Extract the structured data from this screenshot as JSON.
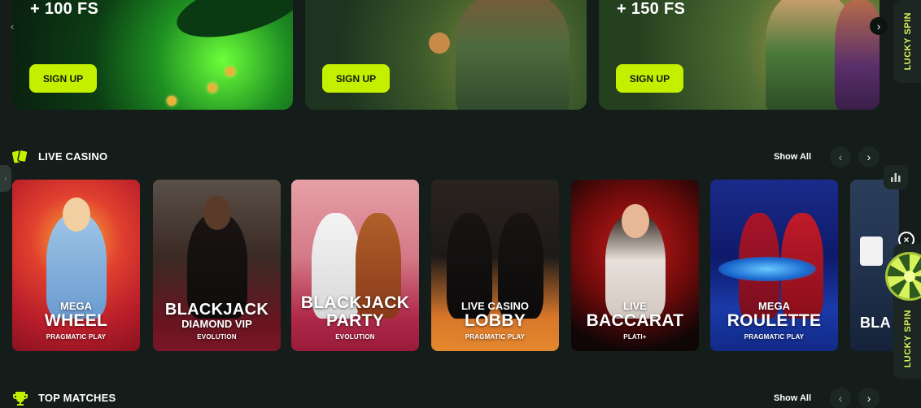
{
  "promos": [
    {
      "title": "+ 100 FS",
      "button": "SIGN UP"
    },
    {
      "title": "",
      "button": "SIGN UP"
    },
    {
      "title": "+ 150 FS",
      "button": "SIGN UP"
    }
  ],
  "live_casino": {
    "title": "LIVE CASINO",
    "show_all": "Show All",
    "games": [
      {
        "line1": "MEGA",
        "line2": "WHEEL",
        "provider": "PRAGMATIC PLAY"
      },
      {
        "line1": "BLACKJACK",
        "line2": "DIAMOND VIP",
        "provider": "EVOLUTION"
      },
      {
        "line1": "BLACKJACK",
        "line2": "PARTY",
        "provider": "EVOLUTION"
      },
      {
        "line1": "LIVE CASINO",
        "line2": "LOBBY",
        "provider": "PRAGMATIC PLAY"
      },
      {
        "line1": "LIVE",
        "line2": "BACCARAT",
        "provider": "PLATI+"
      },
      {
        "line1": "MEGA",
        "line2": "ROULETTE",
        "provider": "PRAGMATIC PLAY"
      },
      {
        "line1": "",
        "line2": "BLA",
        "provider": ""
      }
    ]
  },
  "top_matches": {
    "title": "TOP MATCHES",
    "show_all": "Show All"
  },
  "side": {
    "lucky_spin": "LUCKY SPIN"
  },
  "colors": {
    "accent": "#c4f000",
    "background": "#141d1a"
  }
}
